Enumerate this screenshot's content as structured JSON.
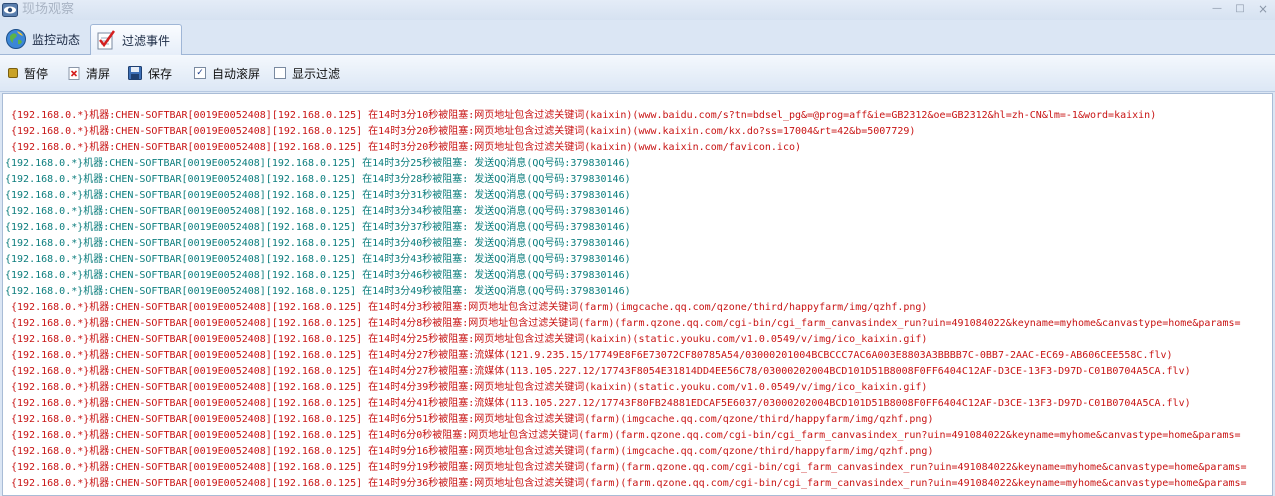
{
  "window": {
    "title": "现场观察"
  },
  "tabs": [
    {
      "label": "监控动态",
      "icon": "globe-icon"
    },
    {
      "label": "过滤事件",
      "icon": "filter-checklist-icon"
    }
  ],
  "toolbar": {
    "pause_label": "暂停",
    "clear_label": "清屏",
    "save_label": "保存",
    "autoscroll_label": "自动滚屏",
    "autoscroll_checked": true,
    "showfilter_label": "显示过滤",
    "showfilter_checked": false
  },
  "log_lines": [
    {
      "color": "red",
      "text": "{192.168.0.*}机器:CHEN-SOFTBAR[0019E0052408][192.168.0.125] 在14时3分10秒被阻塞:网页地址包含过滤关键词(kaixin)(www.baidu.com/s?tn=bdsel_pg&=@prog=aff&ie=GB2312&oe=GB2312&hl=zh-CN&lm=-1&word=kaixin)"
    },
    {
      "color": "red",
      "text": "{192.168.0.*}机器:CHEN-SOFTBAR[0019E0052408][192.168.0.125] 在14时3分20秒被阻塞:网页地址包含过滤关键词(kaixin)(www.kaixin.com/kx.do?ss=17004&rt=42&b=5007729)"
    },
    {
      "color": "red",
      "text": "{192.168.0.*}机器:CHEN-SOFTBAR[0019E0052408][192.168.0.125] 在14时3分20秒被阻塞:网页地址包含过滤关键词(kaixin)(www.kaixin.com/favicon.ico)"
    },
    {
      "color": "teal",
      "text": "{192.168.0.*}机器:CHEN-SOFTBAR[0019E0052408][192.168.0.125] 在14时3分25秒被阻塞: 发送QQ消息(QQ号码:379830146)"
    },
    {
      "color": "teal",
      "text": "{192.168.0.*}机器:CHEN-SOFTBAR[0019E0052408][192.168.0.125] 在14时3分28秒被阻塞: 发送QQ消息(QQ号码:379830146)"
    },
    {
      "color": "teal",
      "text": "{192.168.0.*}机器:CHEN-SOFTBAR[0019E0052408][192.168.0.125] 在14时3分31秒被阻塞: 发送QQ消息(QQ号码:379830146)"
    },
    {
      "color": "teal",
      "text": "{192.168.0.*}机器:CHEN-SOFTBAR[0019E0052408][192.168.0.125] 在14时3分34秒被阻塞: 发送QQ消息(QQ号码:379830146)"
    },
    {
      "color": "teal",
      "text": "{192.168.0.*}机器:CHEN-SOFTBAR[0019E0052408][192.168.0.125] 在14时3分37秒被阻塞: 发送QQ消息(QQ号码:379830146)"
    },
    {
      "color": "teal",
      "text": "{192.168.0.*}机器:CHEN-SOFTBAR[0019E0052408][192.168.0.125] 在14时3分40秒被阻塞: 发送QQ消息(QQ号码:379830146)"
    },
    {
      "color": "teal",
      "text": "{192.168.0.*}机器:CHEN-SOFTBAR[0019E0052408][192.168.0.125] 在14时3分43秒被阻塞: 发送QQ消息(QQ号码:379830146)"
    },
    {
      "color": "teal",
      "text": "{192.168.0.*}机器:CHEN-SOFTBAR[0019E0052408][192.168.0.125] 在14时3分46秒被阻塞: 发送QQ消息(QQ号码:379830146)"
    },
    {
      "color": "teal",
      "text": "{192.168.0.*}机器:CHEN-SOFTBAR[0019E0052408][192.168.0.125] 在14时3分49秒被阻塞: 发送QQ消息(QQ号码:379830146)"
    },
    {
      "color": "red",
      "text": "{192.168.0.*}机器:CHEN-SOFTBAR[0019E0052408][192.168.0.125] 在14时4分3秒被阻塞:网页地址包含过滤关键词(farm)(imgcache.qq.com/qzone/third/happyfarm/img/qzhf.png)"
    },
    {
      "color": "red",
      "text": "{192.168.0.*}机器:CHEN-SOFTBAR[0019E0052408][192.168.0.125] 在14时4分8秒被阻塞:网页地址包含过滤关键词(farm)(farm.qzone.qq.com/cgi-bin/cgi_farm_canvasindex_run?uin=491084022&keyname=myhome&canvastype=home&params="
    },
    {
      "color": "red",
      "text": "{192.168.0.*}机器:CHEN-SOFTBAR[0019E0052408][192.168.0.125] 在14时4分25秒被阻塞:网页地址包含过滤关键词(kaixin)(static.youku.com/v1.0.0549/v/img/ico_kaixin.gif)"
    },
    {
      "color": "red",
      "text": "{192.168.0.*}机器:CHEN-SOFTBAR[0019E0052408][192.168.0.125] 在14时4分27秒被阻塞:流媒体(121.9.235.15/17749E8F6E73072CF80785A54/03000201004BCBCCC7AC6A003E8803A3BBBB7C-0BB7-2AAC-EC69-AB606CEE558C.flv)"
    },
    {
      "color": "red",
      "text": "{192.168.0.*}机器:CHEN-SOFTBAR[0019E0052408][192.168.0.125] 在14时4分27秒被阻塞:流媒体(113.105.227.12/17743F8054E31814DD4EE56C78/03000202004BCD101D51B8008F0FF6404C12AF-D3CE-13F3-D97D-C01B0704A5CA.flv)"
    },
    {
      "color": "red",
      "text": "{192.168.0.*}机器:CHEN-SOFTBAR[0019E0052408][192.168.0.125] 在14时4分39秒被阻塞:网页地址包含过滤关键词(kaixin)(static.youku.com/v1.0.0549/v/img/ico_kaixin.gif)"
    },
    {
      "color": "red",
      "text": "{192.168.0.*}机器:CHEN-SOFTBAR[0019E0052408][192.168.0.125] 在14时4分41秒被阻塞:流媒体(113.105.227.12/17743F80FB24881EDCAF5E6037/03000202004BCD101D51B8008F0FF6404C12AF-D3CE-13F3-D97D-C01B0704A5CA.flv)"
    },
    {
      "color": "red",
      "text": "{192.168.0.*}机器:CHEN-SOFTBAR[0019E0052408][192.168.0.125] 在14时6分51秒被阻塞:网页地址包含过滤关键词(farm)(imgcache.qq.com/qzone/third/happyfarm/img/qzhf.png)"
    },
    {
      "color": "red",
      "text": "{192.168.0.*}机器:CHEN-SOFTBAR[0019E0052408][192.168.0.125] 在14时6分0秒被阻塞:网页地址包含过滤关键词(farm)(farm.qzone.qq.com/cgi-bin/cgi_farm_canvasindex_run?uin=491084022&keyname=myhome&canvastype=home&params="
    },
    {
      "color": "red",
      "text": "{192.168.0.*}机器:CHEN-SOFTBAR[0019E0052408][192.168.0.125] 在14时9分16秒被阻塞:网页地址包含过滤关键词(farm)(imgcache.qq.com/qzone/third/happyfarm/img/qzhf.png)"
    },
    {
      "color": "red",
      "text": "{192.168.0.*}机器:CHEN-SOFTBAR[0019E0052408][192.168.0.125] 在14时9分19秒被阻塞:网页地址包含过滤关键词(farm)(farm.qzone.qq.com/cgi-bin/cgi_farm_canvasindex_run?uin=491084022&keyname=myhome&canvastype=home&params="
    },
    {
      "color": "red",
      "text": "{192.168.0.*}机器:CHEN-SOFTBAR[0019E0052408][192.168.0.125] 在14时9分36秒被阻塞:网页地址包含过滤关键词(farm)(farm.qzone.qq.com/cgi-bin/cgi_farm_canvasindex_run?uin=491084022&keyname=myhome&canvastype=home&params="
    }
  ]
}
